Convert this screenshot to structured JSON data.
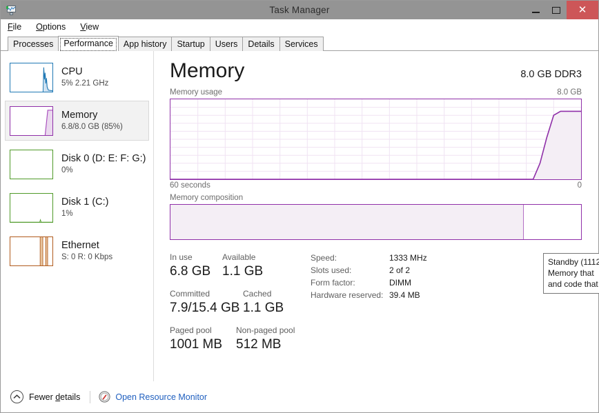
{
  "window": {
    "title": "Task Manager",
    "app_icon": "task-manager-monitor-icon",
    "controls": {
      "minimize": "minimize-icon",
      "maximize": "maximize-icon",
      "close": "✕"
    }
  },
  "menu": [
    {
      "label": "File",
      "accel": "F"
    },
    {
      "label": "Options",
      "accel": "O"
    },
    {
      "label": "View",
      "accel": "V"
    }
  ],
  "tabs": [
    {
      "label": "Processes",
      "active": false
    },
    {
      "label": "Performance",
      "active": true
    },
    {
      "label": "App history",
      "active": false
    },
    {
      "label": "Startup",
      "active": false
    },
    {
      "label": "Users",
      "active": false
    },
    {
      "label": "Details",
      "active": false
    },
    {
      "label": "Services",
      "active": false
    }
  ],
  "sidebar": {
    "items": [
      {
        "title": "CPU",
        "sub": "5% 2.21 GHz",
        "color": "#1f78b4",
        "selected": false,
        "graph": "spike-right"
      },
      {
        "title": "Memory",
        "sub": "6.8/8.0 GB (85%)",
        "color": "#8f2fa8",
        "selected": true,
        "graph": "step-right"
      },
      {
        "title": "Disk 0 (D: E: F: G:)",
        "sub": "0%",
        "color": "#4f9a28",
        "selected": false,
        "graph": "flat"
      },
      {
        "title": "Disk 1 (C:)",
        "sub": "1%",
        "color": "#4f9a28",
        "selected": false,
        "graph": "flat-bump"
      },
      {
        "title": "Ethernet",
        "sub": "S: 0 R: 0 Kbps",
        "color": "#b05a1c",
        "selected": false,
        "graph": "bars-right"
      }
    ]
  },
  "main": {
    "title": "Memory",
    "spec_summary": "8.0 GB DDR3",
    "usage_section": {
      "label": "Memory usage",
      "max_label": "8.0 GB",
      "axis_left": "60 seconds",
      "axis_right": "0"
    },
    "composition_section": {
      "label": "Memory composition",
      "in_use_percent": 86
    },
    "stats": [
      [
        {
          "label": "In use",
          "value": "6.8 GB"
        },
        {
          "label": "Available",
          "value": "1.1 GB"
        }
      ],
      [
        {
          "label": "Committed",
          "value": "7.9/15.4 GB"
        },
        {
          "label": "Cached",
          "value": "1.1 GB"
        }
      ],
      [
        {
          "label": "Paged pool",
          "value": "1001 MB"
        },
        {
          "label": "Non-paged pool",
          "value": "512 MB"
        }
      ]
    ],
    "specs": [
      {
        "key": "Speed:",
        "value": "1333 MHz"
      },
      {
        "key": "Slots used:",
        "value": "2 of 2"
      },
      {
        "key": "Form factor:",
        "value": "DIMM"
      },
      {
        "key": "Hardware reserved:",
        "value": "39.4 MB"
      }
    ]
  },
  "tooltip": {
    "lines": [
      "Standby (1112",
      "Memory that",
      "and code that"
    ]
  },
  "statusbar": {
    "fewer_details": "Fewer details",
    "fewer_details_accel": "d",
    "chevron_icon": "chevron-up-circle-icon",
    "resource_monitor_icon": "resource-monitor-icon",
    "resource_monitor_label": "Open Resource Monitor"
  },
  "chart_data": {
    "type": "area",
    "title": "Memory usage",
    "xlabel": "seconds",
    "ylabel": "GB",
    "ylim": [
      0,
      8.0
    ],
    "xlim": [
      60,
      0
    ],
    "grid": true,
    "x": [
      60,
      55,
      50,
      45,
      40,
      35,
      30,
      25,
      20,
      15,
      10,
      9,
      8,
      7,
      6,
      5,
      4,
      3,
      2,
      1,
      0
    ],
    "values": [
      0,
      0,
      0,
      0,
      0,
      0,
      0,
      0,
      0,
      0,
      0,
      0,
      0,
      0.0,
      1.6,
      4.2,
      6.4,
      6.8,
      6.8,
      6.8,
      6.8
    ],
    "series_color": "#8f2fa8",
    "fill_color": "#f4eef5",
    "grid_rows": 10,
    "grid_cols": 15
  }
}
